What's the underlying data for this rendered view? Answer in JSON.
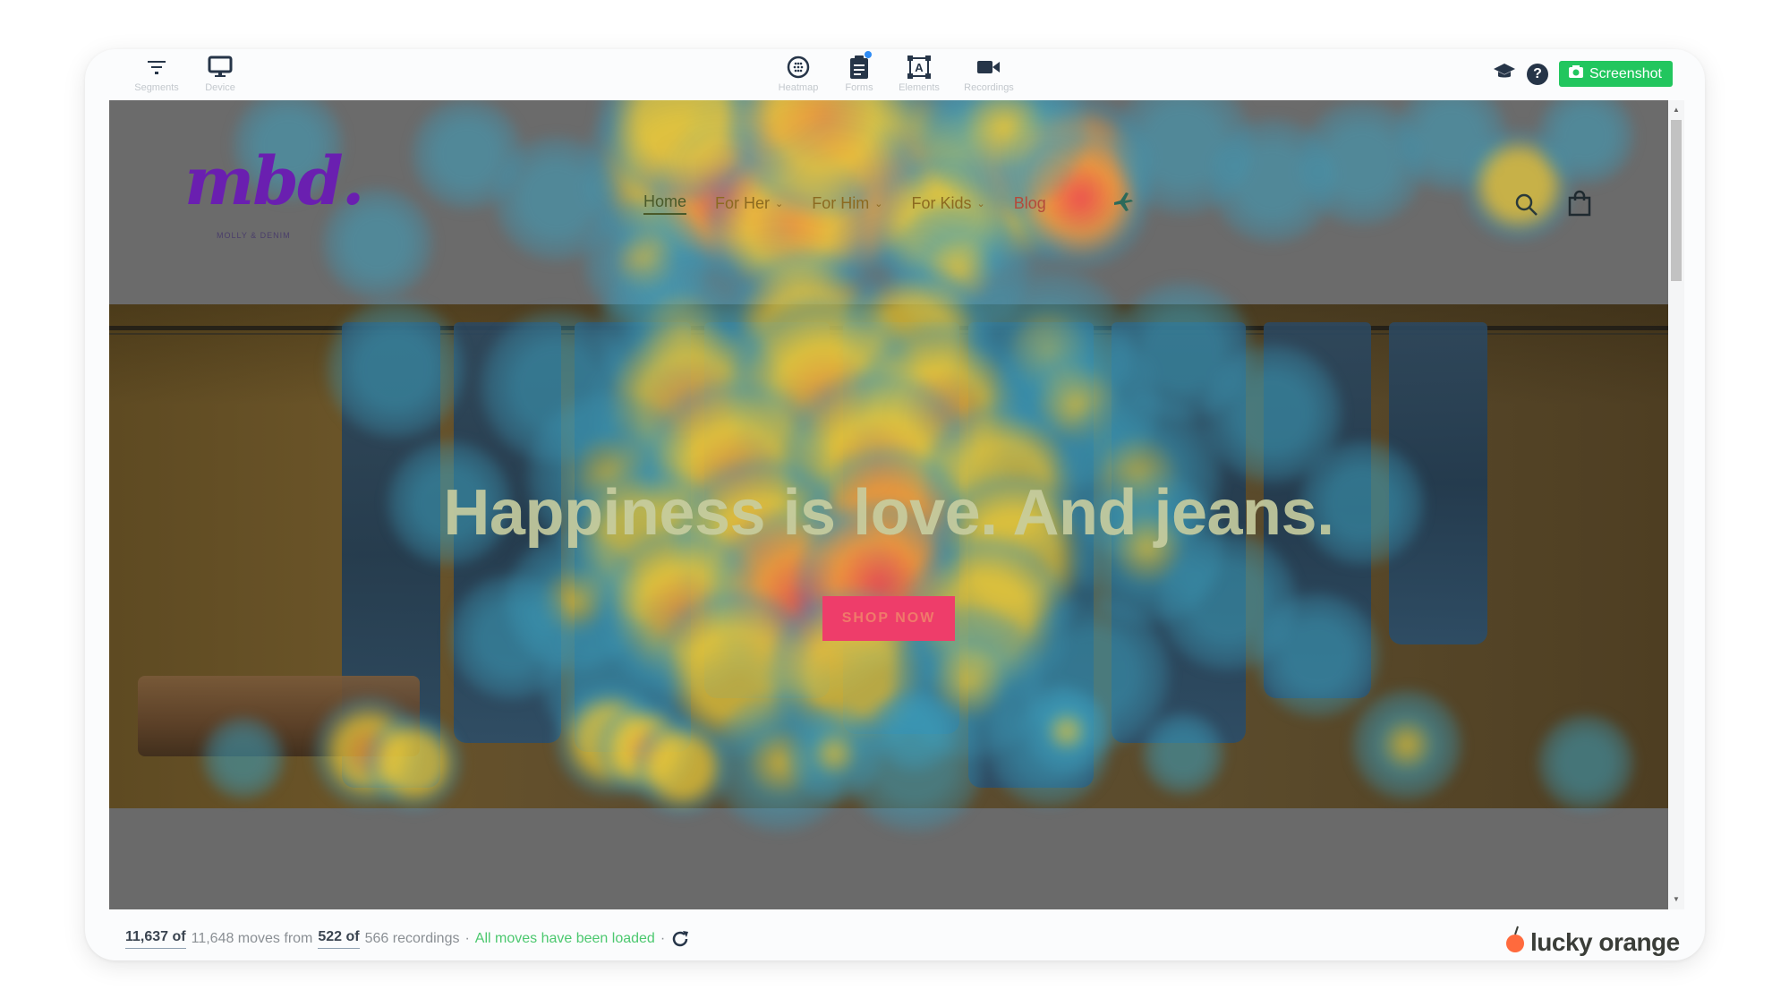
{
  "toolbar": {
    "left": [
      {
        "label": "Segments",
        "icon": "filter-icon"
      },
      {
        "label": "Device",
        "icon": "monitor-icon"
      }
    ],
    "center": [
      {
        "label": "Heatmap",
        "icon": "heatmap-icon"
      },
      {
        "label": "Forms",
        "icon": "clipboard-icon",
        "badge": true
      },
      {
        "label": "Elements",
        "icon": "elements-icon"
      },
      {
        "label": "Recordings",
        "icon": "video-camera-icon"
      }
    ],
    "screenshot_label": "Screenshot",
    "accent_color": "#22c65e"
  },
  "site": {
    "logo": "mbd.",
    "logo_sub": "MOLLY & DENIM",
    "nav": [
      {
        "label": "Home",
        "dropdown": false
      },
      {
        "label": "For Her",
        "dropdown": true
      },
      {
        "label": "For Him",
        "dropdown": true
      },
      {
        "label": "For Kids",
        "dropdown": true
      },
      {
        "label": "Blog",
        "dropdown": false
      }
    ],
    "hero_title": "Happiness is love. And jeans.",
    "cta_label": "SHOP NOW",
    "cta_color": "#ee3d6a"
  },
  "status": {
    "moves_loaded": "11,637 of",
    "moves_total_text": "11,648 moves from",
    "recordings_loaded": "522 of",
    "recordings_total_text": "566 recordings",
    "sep": "·",
    "loaded_message": "All moves have been loaded"
  },
  "brand": {
    "name": "lucky orange",
    "color": "#ff6a3d"
  }
}
